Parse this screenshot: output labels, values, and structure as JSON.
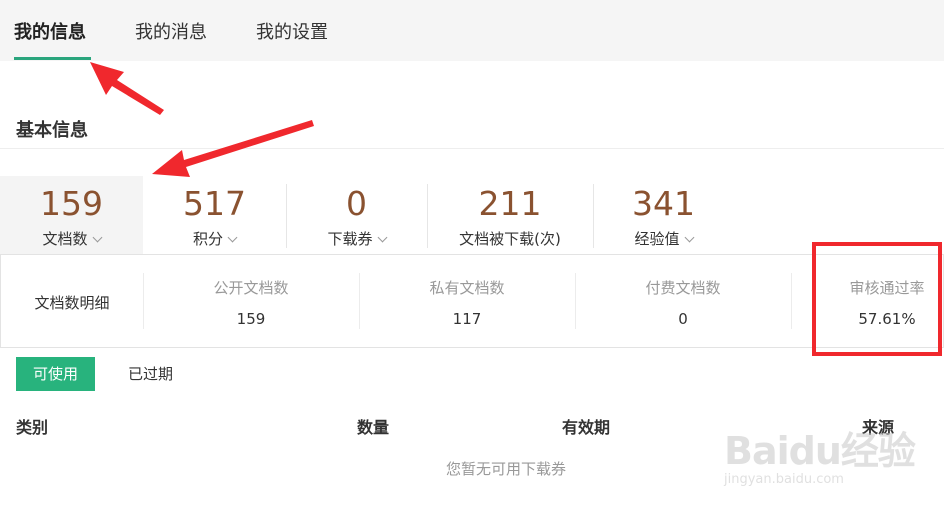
{
  "tabs": [
    {
      "label": "我的信息",
      "active": true
    },
    {
      "label": "我的消息",
      "active": false
    },
    {
      "label": "我的设置",
      "active": false
    }
  ],
  "section_title": "基本信息",
  "stats": [
    {
      "value": "159",
      "label": "文档数"
    },
    {
      "value": "517",
      "label": "积分"
    },
    {
      "value": "0",
      "label": "下载券"
    },
    {
      "value": "211",
      "label": "文档被下载(次)"
    },
    {
      "value": "341",
      "label": "经验值"
    }
  ],
  "detail": {
    "title": "文档数明细",
    "columns": [
      {
        "header": "公开文档数",
        "value": "159"
      },
      {
        "header": "私有文档数",
        "value": "117"
      },
      {
        "header": "付费文档数",
        "value": "0"
      },
      {
        "header": "审核通过率",
        "value": "57.61%"
      }
    ]
  },
  "coupon_tabs": {
    "available": "可使用",
    "expired": "已过期"
  },
  "table": {
    "headers": [
      "类别",
      "数量",
      "有效期",
      "来源"
    ],
    "empty_text": "您暂无可用下载券"
  },
  "watermark": {
    "logo": "Baidu经验",
    "url": "jingyan.baidu.com"
  },
  "colors": {
    "accent": "#28b37d",
    "stat_value": "#8a5230",
    "annotation": "#f0282d"
  }
}
